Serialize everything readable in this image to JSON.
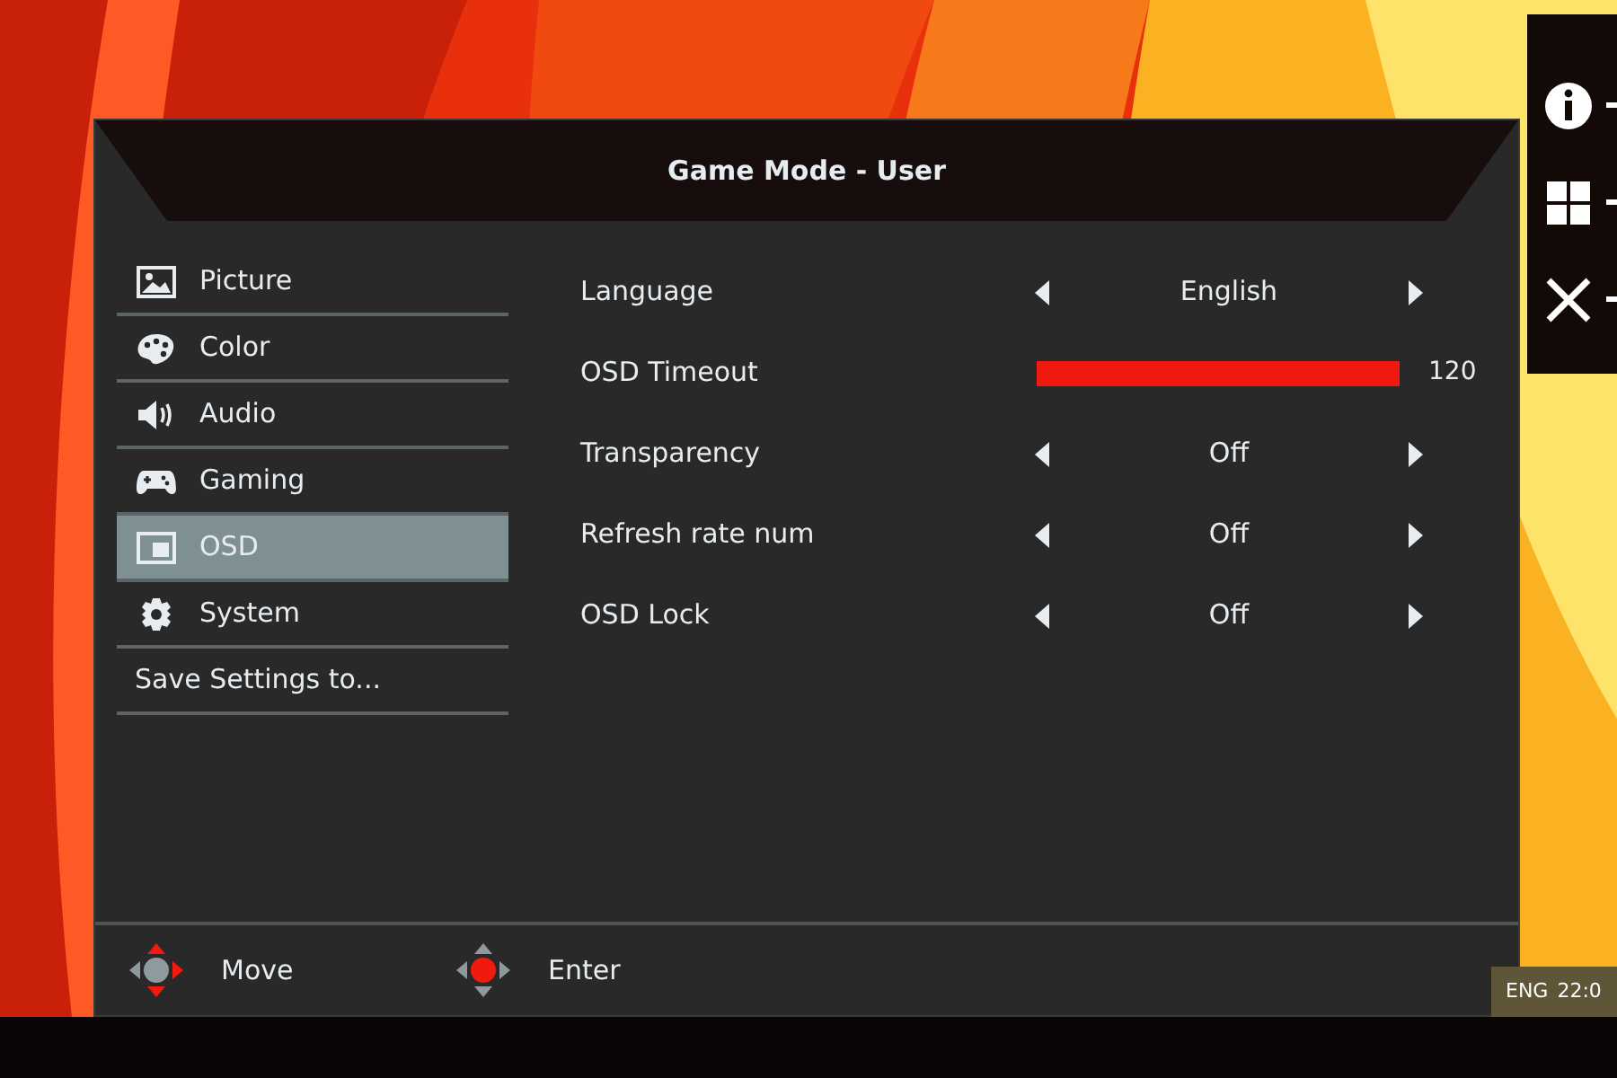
{
  "osd": {
    "title": "Game Mode - User",
    "menu": [
      {
        "kind": "picture",
        "label": "Picture",
        "selected": false
      },
      {
        "kind": "color",
        "label": "Color",
        "selected": false
      },
      {
        "kind": "audio",
        "label": "Audio",
        "selected": false
      },
      {
        "kind": "gaming",
        "label": "Gaming",
        "selected": false
      },
      {
        "kind": "osd",
        "label": "OSD",
        "selected": true
      },
      {
        "kind": "system",
        "label": "System",
        "selected": false
      },
      {
        "kind": "text",
        "label": "Save Settings to...",
        "selected": false
      }
    ],
    "settings": [
      {
        "kind": "selector",
        "label": "Language",
        "value": "English"
      },
      {
        "kind": "slider",
        "label": "OSD Timeout",
        "level": 1,
        "reading": "120"
      },
      {
        "kind": "selector",
        "label": "Transparency",
        "value": "Off"
      },
      {
        "kind": "selector",
        "label": "Refresh rate num",
        "value": "Off"
      },
      {
        "kind": "selector",
        "label": "OSD Lock",
        "value": "Off"
      }
    ],
    "hints": [
      {
        "kind": "move",
        "label": "Move"
      },
      {
        "kind": "enter",
        "label": "Enter"
      }
    ]
  },
  "hotkeys": [
    {
      "kind": "info"
    },
    {
      "kind": "input"
    },
    {
      "kind": "close"
    }
  ],
  "taskbar": {
    "language": "ENG",
    "clock": "22:0"
  }
}
